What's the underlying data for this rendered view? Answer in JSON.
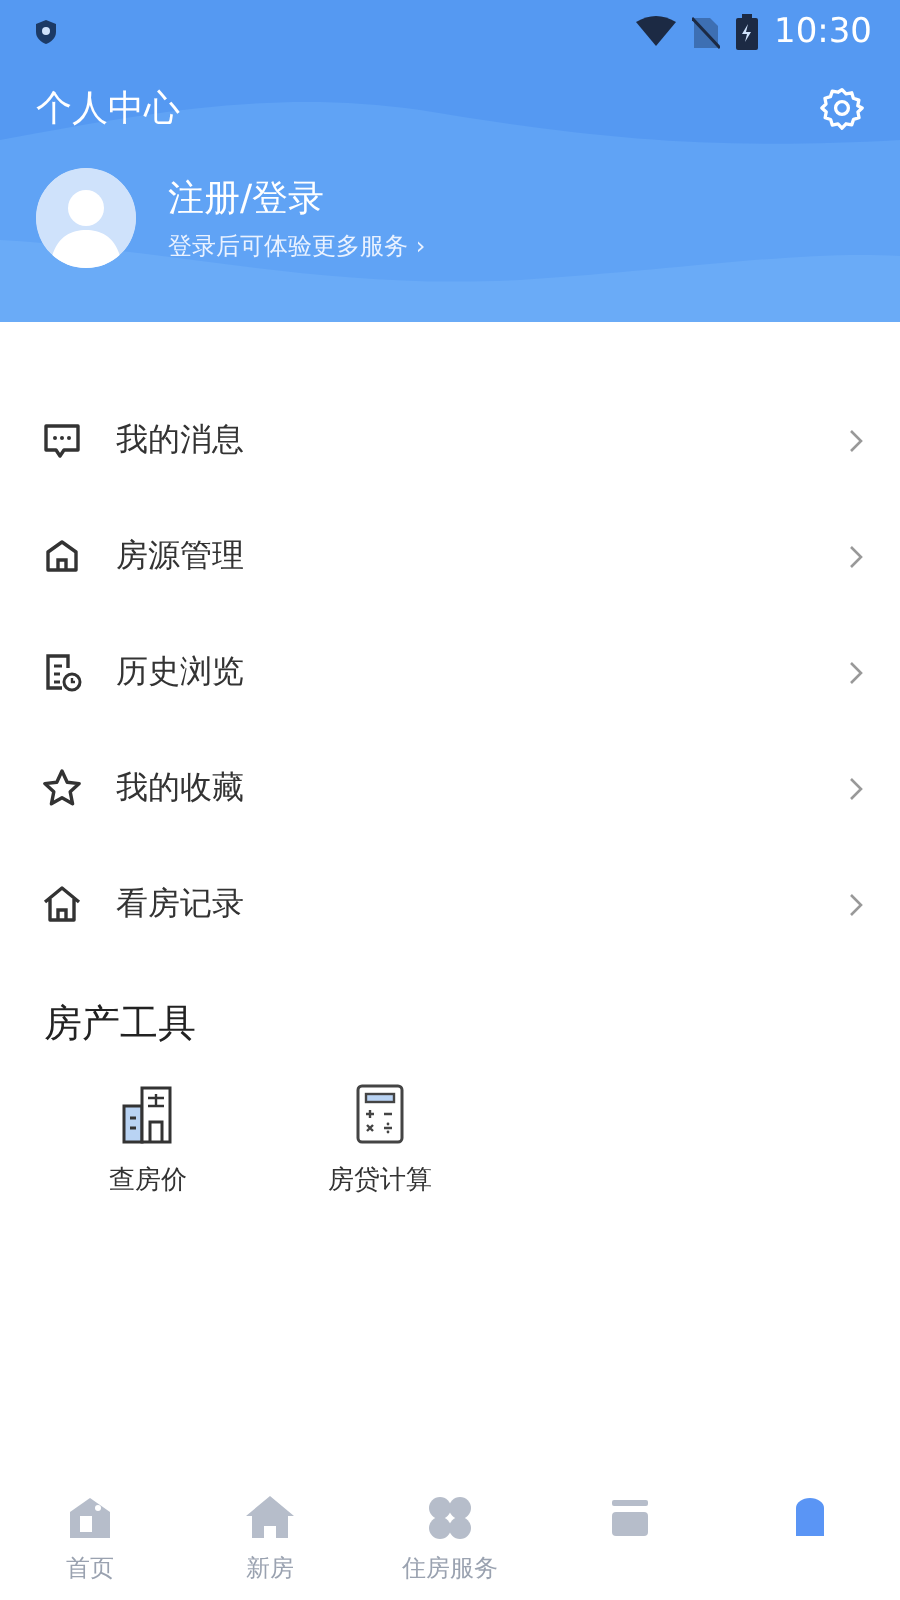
{
  "status_bar": {
    "time": "10:30"
  },
  "header": {
    "title": "个人中心",
    "login": "注册/登录",
    "subtitle": "登录后可体验更多服务 ›"
  },
  "menu": [
    {
      "label": "我的消息"
    },
    {
      "label": "房源管理"
    },
    {
      "label": "历史浏览"
    },
    {
      "label": "我的收藏"
    },
    {
      "label": "看房记录"
    }
  ],
  "tools": {
    "title": "房产工具",
    "items": [
      {
        "label": "查房价"
      },
      {
        "label": "房贷计算"
      }
    ]
  },
  "tab_bar": [
    {
      "label": "首页",
      "selected": false
    },
    {
      "label": "新房",
      "selected": false
    },
    {
      "label": "住房服务",
      "selected": false
    },
    {
      "selected": false
    },
    {
      "selected": true
    }
  ]
}
